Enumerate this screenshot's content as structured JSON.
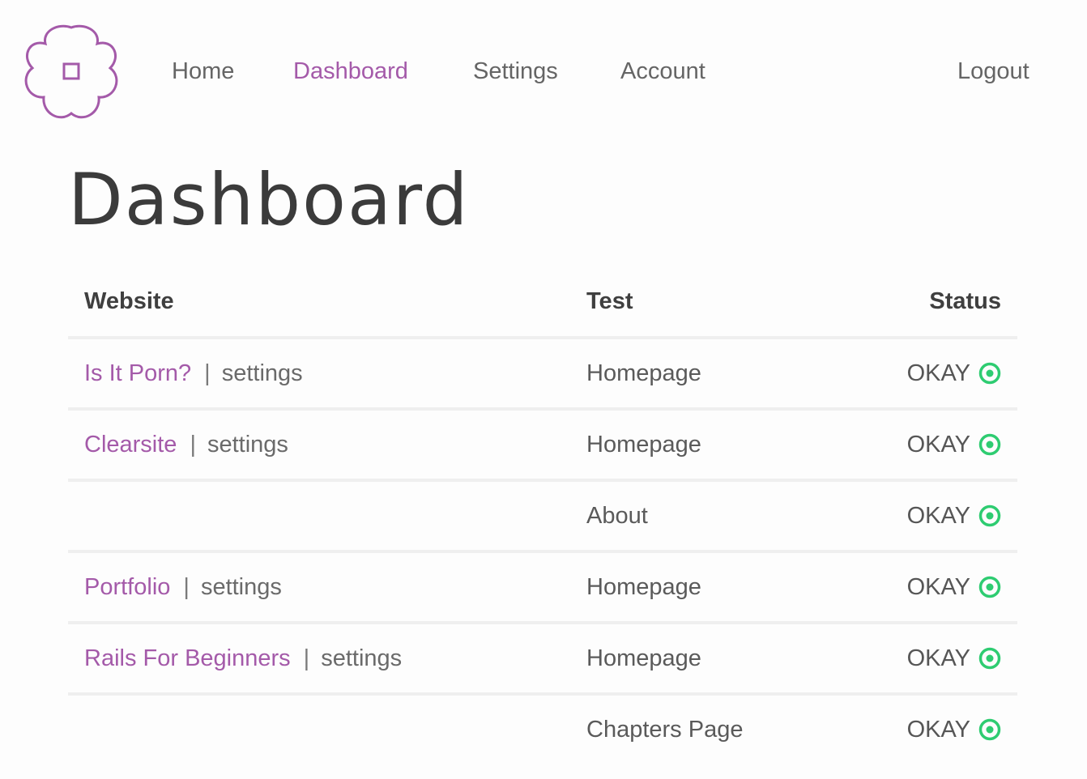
{
  "nav": {
    "items": [
      {
        "label": "Home",
        "active": false
      },
      {
        "label": "Dashboard",
        "active": true
      },
      {
        "label": "Settings",
        "active": false
      },
      {
        "label": "Account",
        "active": false
      }
    ],
    "logout_label": "Logout",
    "logo_icon": "flower-logo-icon"
  },
  "page": {
    "title": "Dashboard"
  },
  "table": {
    "headers": {
      "website": "Website",
      "test": "Test",
      "status": "Status"
    },
    "settings_label": "settings",
    "separator": "|",
    "rows": [
      {
        "website": "Is It Porn?",
        "test": "Homepage",
        "status": "OKAY"
      },
      {
        "website": "Clearsite",
        "test": "Homepage",
        "status": "OKAY"
      },
      {
        "website": "",
        "test": "About",
        "status": "OKAY"
      },
      {
        "website": "Portfolio",
        "test": "Homepage",
        "status": "OKAY"
      },
      {
        "website": "Rails For Beginners",
        "test": "Homepage",
        "status": "OKAY"
      },
      {
        "website": "",
        "test": "Chapters Page",
        "status": "OKAY"
      }
    ]
  },
  "colors": {
    "accent": "#a45aa9",
    "status_ok": "#2ecc71",
    "text": "#5a5a5a"
  }
}
